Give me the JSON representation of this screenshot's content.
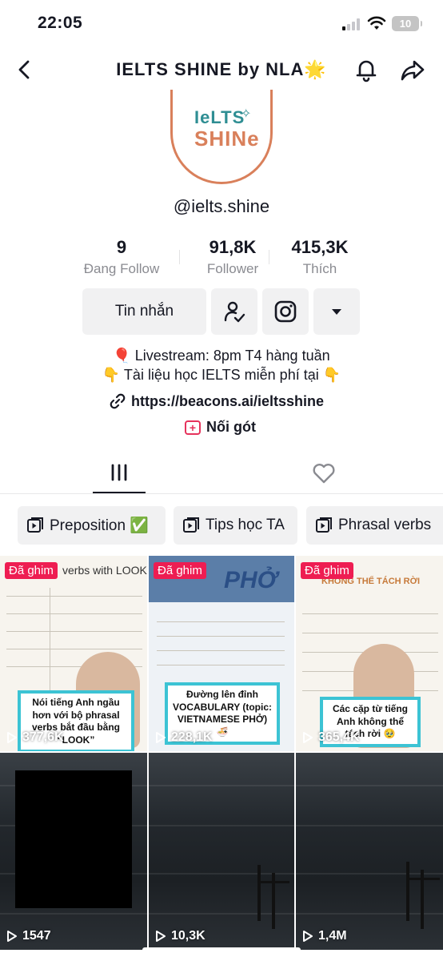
{
  "status": {
    "time": "22:05",
    "battery": "10"
  },
  "header": {
    "title": "IELTS  SHINE  by  NLA🌟"
  },
  "avatar": {
    "logo_top": "IeLTS",
    "logo_bottom": "SHINe",
    "logo_mark": "✧"
  },
  "profile": {
    "username": "@ielts.shine"
  },
  "stats": [
    {
      "value": "9",
      "label": "Đang Follow"
    },
    {
      "value": "91,8K",
      "label": "Follower"
    },
    {
      "value": "415,3K",
      "label": "Thích"
    }
  ],
  "actions": {
    "message_label": "Tin nhắn"
  },
  "bio": {
    "line1": "🎈 Livestream: 8pm T4 hàng tuần",
    "line2": "👇 Tài liệu học IELTS miễn phí tại 👇",
    "link": "https://beacons.ai/ieltsshine",
    "favorites": "Nối gót"
  },
  "playlists": [
    "Preposition ✅",
    "Tips học TA",
    "Phrasal verbs"
  ],
  "videos": [
    {
      "pinned": "Đã ghim",
      "views": "377,6K",
      "caption": "Nói tiếng Anh ngầu hơn với bộ phrasal verbs bắt đầu bằng “LOOK”",
      "heading": "verbs with LOOK"
    },
    {
      "pinned": "Đã ghim",
      "views": "228,1K",
      "caption": "Đường lên đỉnh VOCABULARY (topic: VIETNAMESE PHỞ) 🍜",
      "heading": "PHỞ"
    },
    {
      "pinned": "Đã ghim",
      "views": "365,4K",
      "caption": "Các cặp từ tiếng Anh không thể tách rời 🥹",
      "heading": "KHÔNG THỂ TÁCH RỜI"
    },
    {
      "views": "1547"
    },
    {
      "views": "10,3K"
    },
    {
      "views": "1,4M"
    }
  ]
}
